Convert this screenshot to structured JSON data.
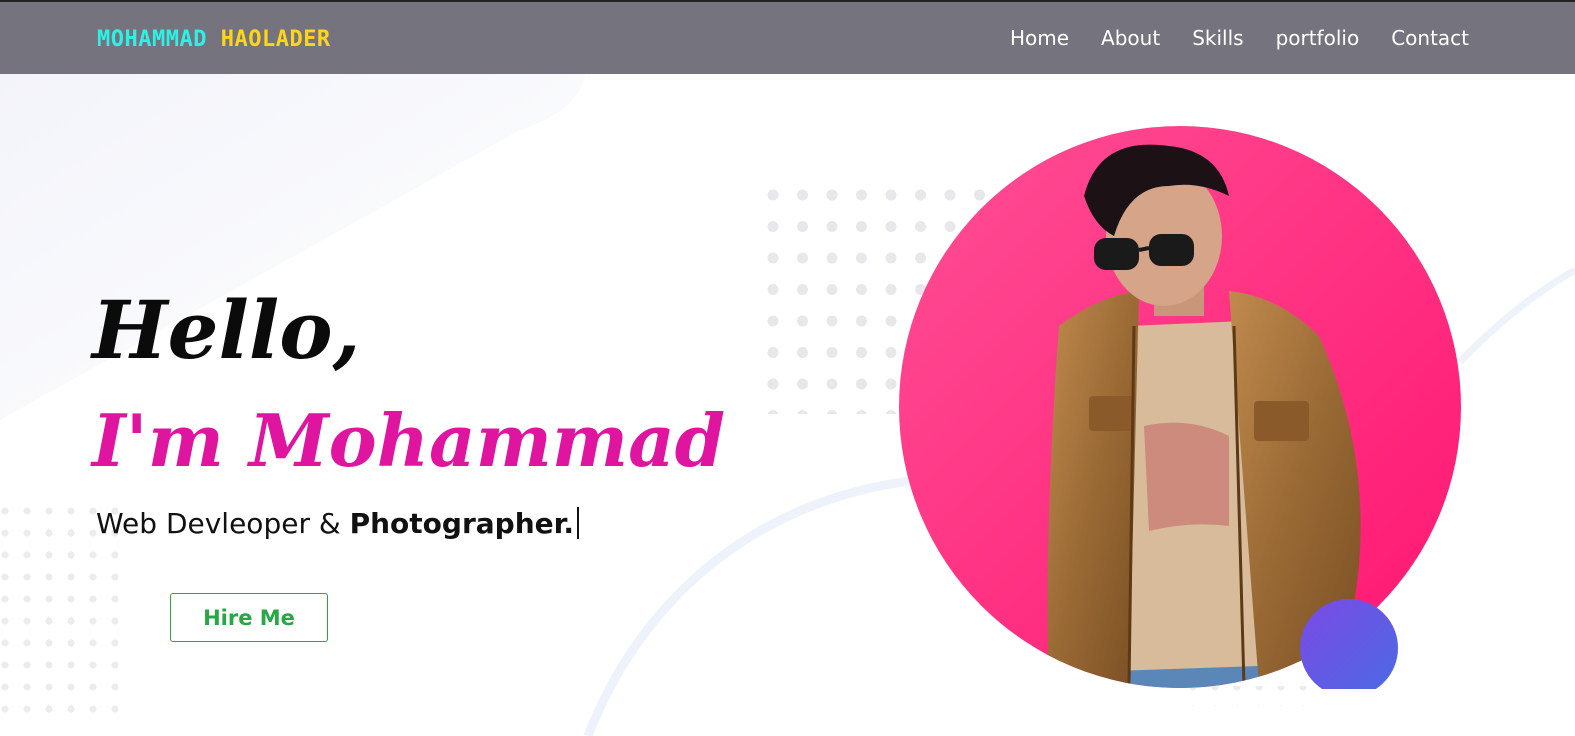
{
  "brand": {
    "first": "MOHAMMAD",
    "last": "HAOLADER"
  },
  "nav": [
    {
      "label": "Home"
    },
    {
      "label": "About"
    },
    {
      "label": "Skills"
    },
    {
      "label": "portfolio"
    },
    {
      "label": "Contact"
    }
  ],
  "hero": {
    "greeting": "Hello,",
    "intro": "I'm Mohammad",
    "role_prefix": "Web Devleoper & ",
    "role_highlight": "Photographer.",
    "cta": "Hire Me"
  },
  "colors": {
    "navbar": "#75737d",
    "brand_first": "#2ff0e6",
    "brand_last": "#ffd51a",
    "intro_accent": "#e0159f",
    "cta": "#27a844",
    "circle": "#ff2b7d",
    "blob": "#5a5fe3"
  },
  "icons": [
    "typing-caret"
  ]
}
